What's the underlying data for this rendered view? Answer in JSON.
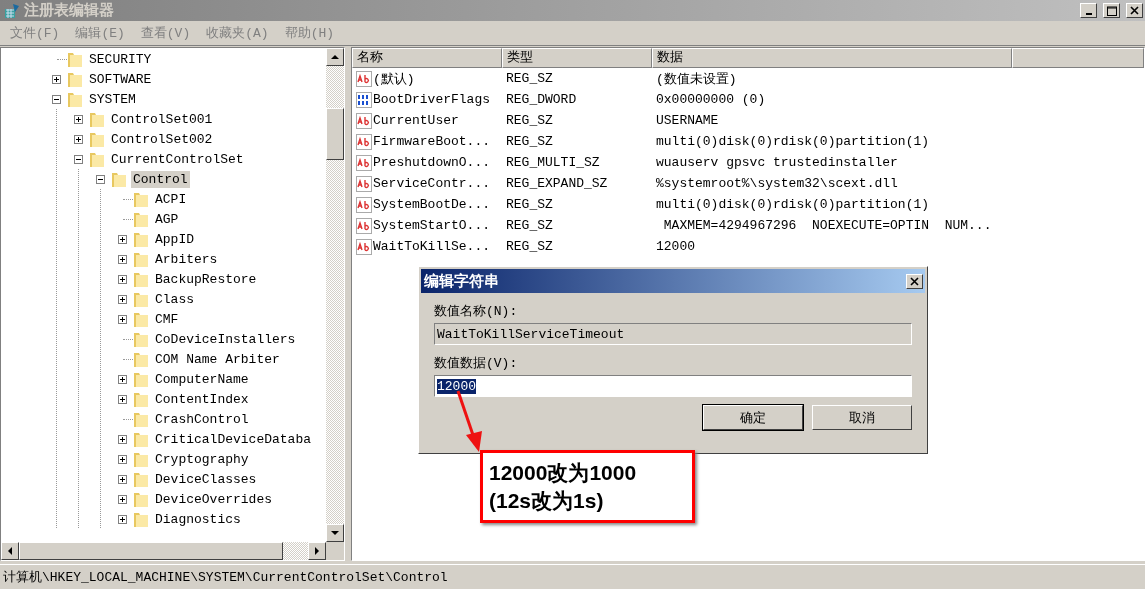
{
  "window": {
    "title": "注册表编辑器"
  },
  "menu": [
    "文件(F)",
    "编辑(E)",
    "查看(V)",
    "收藏夹(A)",
    "帮助(H)"
  ],
  "tree": [
    {
      "label": "SECURITY",
      "kind": "leaf",
      "selected": false
    },
    {
      "label": "SOFTWARE",
      "kind": "branch",
      "expanded": false,
      "selected": false
    },
    {
      "label": "SYSTEM",
      "kind": "branch",
      "expanded": true,
      "selected": false,
      "children": [
        {
          "label": "ControlSet001",
          "kind": "branch",
          "expanded": false,
          "selected": false
        },
        {
          "label": "ControlSet002",
          "kind": "branch",
          "expanded": false,
          "selected": false
        },
        {
          "label": "CurrentControlSet",
          "kind": "branch",
          "expanded": true,
          "selected": false,
          "children": [
            {
              "label": "Control",
              "kind": "branch",
              "expanded": true,
              "selected": true,
              "children": [
                {
                  "label": "ACPI",
                  "kind": "leaf",
                  "selected": false
                },
                {
                  "label": "AGP",
                  "kind": "leaf",
                  "selected": false
                },
                {
                  "label": "AppID",
                  "kind": "branch",
                  "expanded": false,
                  "selected": false
                },
                {
                  "label": "Arbiters",
                  "kind": "branch",
                  "expanded": false,
                  "selected": false
                },
                {
                  "label": "BackupRestore",
                  "kind": "branch",
                  "expanded": false,
                  "selected": false
                },
                {
                  "label": "Class",
                  "kind": "branch",
                  "expanded": false,
                  "selected": false
                },
                {
                  "label": "CMF",
                  "kind": "branch",
                  "expanded": false,
                  "selected": false
                },
                {
                  "label": "CoDeviceInstallers",
                  "kind": "leaf",
                  "selected": false
                },
                {
                  "label": "COM Name Arbiter",
                  "kind": "leaf",
                  "selected": false
                },
                {
                  "label": "ComputerName",
                  "kind": "branch",
                  "expanded": false,
                  "selected": false
                },
                {
                  "label": "ContentIndex",
                  "kind": "branch",
                  "expanded": false,
                  "selected": false
                },
                {
                  "label": "CrashControl",
                  "kind": "leaf",
                  "selected": false
                },
                {
                  "label": "CriticalDeviceDataba",
                  "kind": "branch",
                  "expanded": false,
                  "selected": false
                },
                {
                  "label": "Cryptography",
                  "kind": "branch",
                  "expanded": false,
                  "selected": false
                },
                {
                  "label": "DeviceClasses",
                  "kind": "branch",
                  "expanded": false,
                  "selected": false
                },
                {
                  "label": "DeviceOverrides",
                  "kind": "branch",
                  "expanded": false,
                  "selected": false
                },
                {
                  "label": "Diagnostics",
                  "kind": "branch",
                  "expanded": false,
                  "selected": false
                }
              ]
            }
          ]
        }
      ]
    }
  ],
  "list": {
    "columns": [
      "名称",
      "类型",
      "数据"
    ],
    "rows": [
      {
        "name": "(默认)",
        "type": "REG_SZ",
        "data": "(数值未设置)",
        "kind": "text"
      },
      {
        "name": "BootDriverFlags",
        "type": "REG_DWORD",
        "data": "0x00000000 (0)",
        "kind": "binary"
      },
      {
        "name": "CurrentUser",
        "type": "REG_SZ",
        "data": "USERNAME",
        "kind": "text"
      },
      {
        "name": "FirmwareBoot...",
        "type": "REG_SZ",
        "data": "multi(0)disk(0)rdisk(0)partition(1)",
        "kind": "text"
      },
      {
        "name": "PreshutdownO...",
        "type": "REG_MULTI_SZ",
        "data": "wuauserv gpsvc trustedinstaller",
        "kind": "text"
      },
      {
        "name": "ServiceContr...",
        "type": "REG_EXPAND_SZ",
        "data": "%systemroot%\\system32\\scext.dll",
        "kind": "text"
      },
      {
        "name": "SystemBootDe...",
        "type": "REG_SZ",
        "data": "multi(0)disk(0)rdisk(0)partition(1)",
        "kind": "text"
      },
      {
        "name": "SystemStartO...",
        "type": "REG_SZ",
        "data": " MAXMEM=4294967296  NOEXECUTE=OPTIN  NUM...",
        "kind": "text"
      },
      {
        "name": "WaitToKillSe...",
        "type": "REG_SZ",
        "data": "12000",
        "kind": "text"
      }
    ]
  },
  "dialog": {
    "title": "编辑字符串",
    "name_label": "数值名称(N):",
    "name_value": "WaitToKillServiceTimeout",
    "data_label": "数值数据(V):",
    "data_field": {
      "value": "12000",
      "selected": true
    },
    "buttons": [
      "确定",
      "取消"
    ]
  },
  "callout": {
    "lines": [
      "12000改为1000",
      "(12s改为1s)"
    ]
  },
  "status_bar": {
    "text": "计算机\\HKEY_LOCAL_MACHINE\\SYSTEM\\CurrentControlSet\\Control"
  }
}
